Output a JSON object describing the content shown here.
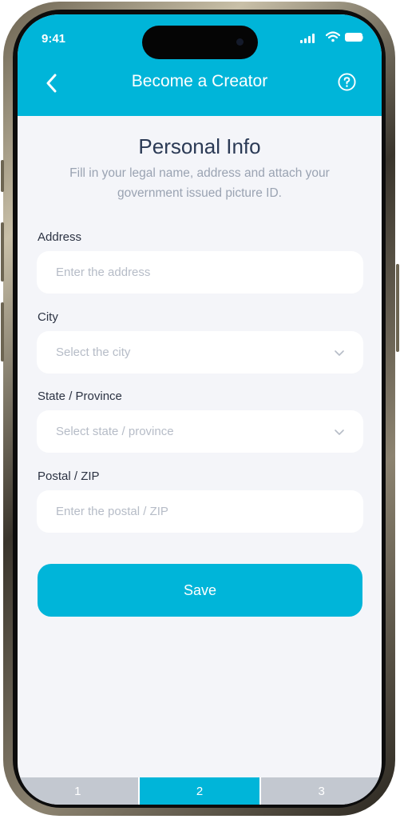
{
  "status": {
    "time": "9:41"
  },
  "header": {
    "title": "Become a Creator",
    "back_icon": "chevron-left-icon",
    "help_icon": "question-circle-icon"
  },
  "section": {
    "title": "Personal Info",
    "subtitle": "Fill in your legal name, address and attach your government issued picture ID."
  },
  "fields": {
    "address": {
      "label": "Address",
      "placeholder": "Enter the address"
    },
    "city": {
      "label": "City",
      "placeholder": "Select the city"
    },
    "state": {
      "label": "State / Province",
      "placeholder": "Select state / province"
    },
    "postal": {
      "label": "Postal / ZIP",
      "placeholder": "Enter the postal / ZIP"
    }
  },
  "save_label": "Save",
  "steps": [
    {
      "label": "1"
    },
    {
      "label": "2",
      "active": true
    },
    {
      "label": "3"
    }
  ],
  "colors": {
    "accent": "#00b5d9",
    "background": "#f4f5f9",
    "field": "#ffffff",
    "step_inactive": "#c3c8d0"
  }
}
